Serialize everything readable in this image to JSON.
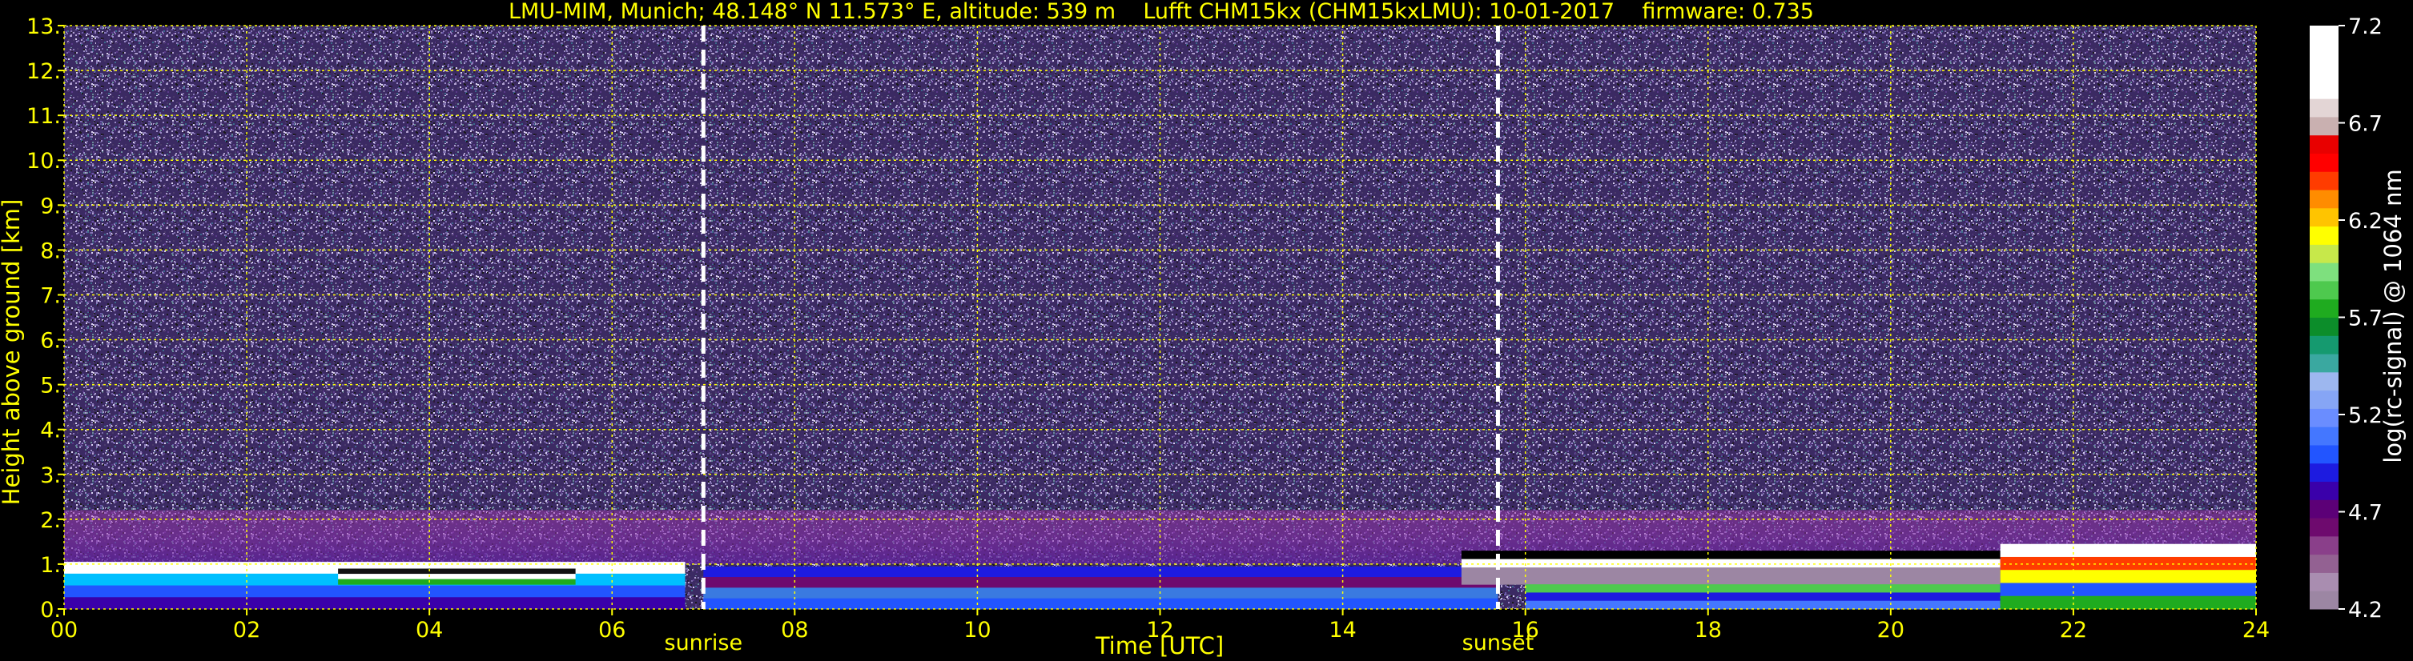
{
  "chart_data": {
    "type": "heatmap",
    "title": "LMU-MIM, Munich; 48.148° N 11.573° E, altitude: 539 m    Lufft CHM15kx (CHM15kxLMU): 10-01-2017    firmware: 0.735",
    "xlabel": "Time [UTC]",
    "ylabel": "Height above ground [km]",
    "xlim": [
      0,
      24
    ],
    "ylim": [
      0,
      13
    ],
    "x_ticks": [
      "00",
      "02",
      "04",
      "06",
      "08",
      "10",
      "12",
      "14",
      "16",
      "18",
      "20",
      "22",
      "24"
    ],
    "y_ticks": [
      "0.",
      "1.",
      "2.",
      "3.",
      "4.",
      "5.",
      "6.",
      "7.",
      "8.",
      "9.",
      "10.",
      "11.",
      "12.",
      "13."
    ],
    "grid": true,
    "colorbar": {
      "label": "log(rc-signal) @ 1064 nm",
      "range": [
        4.2,
        7.2
      ],
      "ticks": [
        "4.2",
        "4.7",
        "5.2",
        "5.7",
        "6.2",
        "6.7",
        "7.2"
      ],
      "colors": [
        "#9c86a3",
        "#a98db0",
        "#936192",
        "#8a3f8a",
        "#6e0a6e",
        "#5c0077",
        "#3a00aa",
        "#1d1be0",
        "#2255ff",
        "#4477ff",
        "#6a8dff",
        "#86a5f5",
        "#9db7ef",
        "#3aa8a0",
        "#159a6f",
        "#0c8d2a",
        "#1fab1f",
        "#4ec94e",
        "#7ee07e",
        "#c7e84a",
        "#ffff00",
        "#ffc400",
        "#ff8c00",
        "#ff3c00",
        "#ff0000",
        "#e80000",
        "#c9b0b0",
        "#e3d5d5",
        "#ffffff",
        "#ffffff",
        "#ffffff",
        "#ffffff"
      ]
    },
    "background_colors": [
      "#5a3a8a",
      "#7a6aaa",
      "#3a2a5a",
      "#9a8ac8",
      "#2a1a3a",
      "#6a5aa8",
      "#8a7ab8",
      "#4a3a6a",
      "#b0a0d0",
      "#3a6a8a",
      "#d8d0f0",
      "#1a1a1a",
      "#6a8a9a"
    ],
    "annotations": [
      {
        "label": "sunrise",
        "x": 7.0
      },
      {
        "label": "sunset",
        "x": 15.7
      }
    ],
    "layer_segments": [
      {
        "t0": 0.0,
        "t1": 6.8,
        "top": 1.05,
        "bottom": 0.0,
        "kind": "white-band"
      },
      {
        "t0": 3.0,
        "t1": 5.6,
        "top": 0.9,
        "bottom": 0.55,
        "kind": "cloud-dark"
      },
      {
        "t0": 7.0,
        "t1": 15.7,
        "top": 0.95,
        "bottom": 0.0,
        "kind": "blue-purple"
      },
      {
        "t0": 15.3,
        "t1": 21.2,
        "top": 1.3,
        "bottom": 0.55,
        "kind": "black-white"
      },
      {
        "t0": 16.0,
        "t1": 21.2,
        "top": 0.55,
        "bottom": 0.0,
        "kind": "green-base"
      },
      {
        "t0": 21.2,
        "t1": 24.0,
        "top": 1.45,
        "bottom": 0.0,
        "kind": "mixed-cloud"
      }
    ]
  }
}
